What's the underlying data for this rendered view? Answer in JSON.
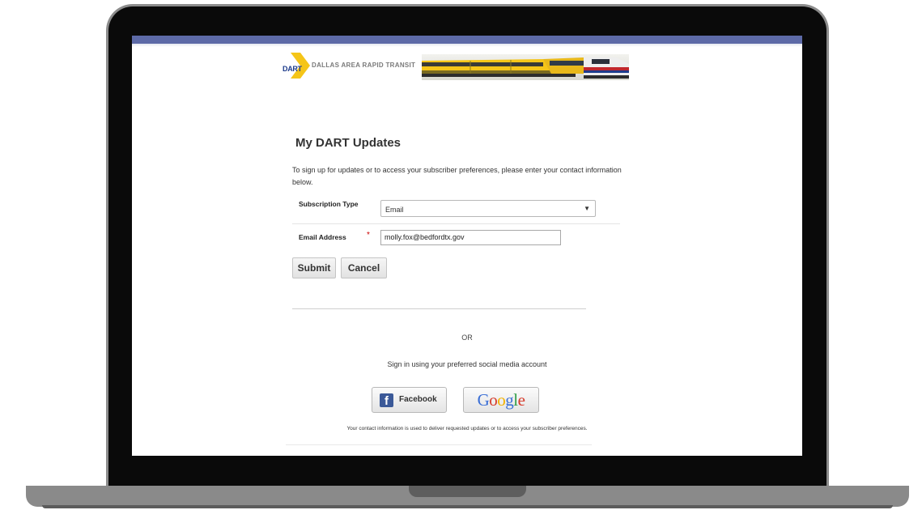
{
  "banner": {
    "logo_text": "DART",
    "title": "DALLAS AREA RAPID TRANSIT"
  },
  "page": {
    "title": "My DART Updates",
    "intro": "To sign up for updates or to access your subscriber preferences, please enter your contact information below."
  },
  "form": {
    "subscription_type_label": "Subscription Type",
    "subscription_type_value": "Email",
    "email_label": "Email Address",
    "required_marker": "*",
    "email_value": "molly.fox@bedfordtx.gov",
    "submit_label": "Submit",
    "cancel_label": "Cancel"
  },
  "social": {
    "or_text": "OR",
    "prompt": "Sign in using your preferred social media account",
    "facebook_label": "Facebook",
    "google_letters": [
      "G",
      "o",
      "o",
      "g",
      "l",
      "e"
    ],
    "google_colors": [
      "#3b6fd6",
      "#d63b2b",
      "#f2b100",
      "#3b6fd6",
      "#2f9d47",
      "#d63b2b"
    ]
  },
  "footnote": "Your contact information is used to deliver requested updates or to access your subscriber preferences.",
  "colors": {
    "topbar": "#5d6aa7",
    "dart_yellow": "#f5c518",
    "dart_blue": "#1e3c8c",
    "facebook_blue": "#3b5998"
  }
}
